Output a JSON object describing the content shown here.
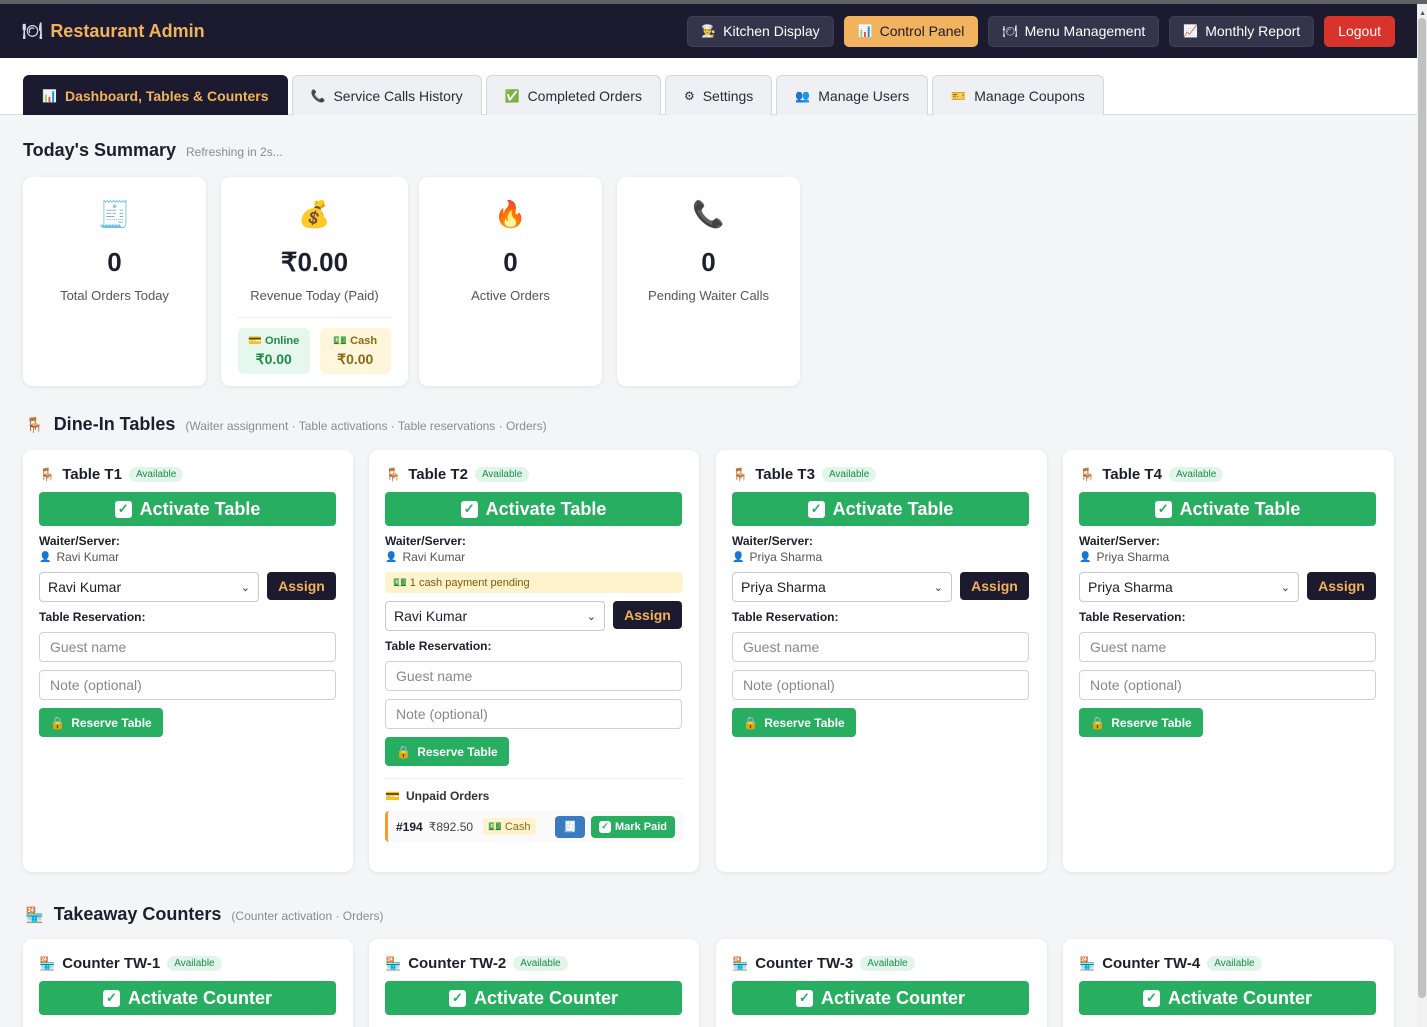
{
  "app": {
    "title": "Restaurant Admin"
  },
  "header_buttons": [
    {
      "label": "Kitchen Display",
      "icon": "chef-icon"
    },
    {
      "label": "Control Panel",
      "icon": "chart-icon"
    },
    {
      "label": "Menu Management",
      "icon": "plate-icon"
    },
    {
      "label": "Monthly Report",
      "icon": "trend-icon"
    }
  ],
  "logout_label": "Logout",
  "tabs": [
    {
      "label": "Dashboard, Tables & Counters",
      "icon": "chart-icon"
    },
    {
      "label": "Service Calls History",
      "icon": "phone-icon"
    },
    {
      "label": "Completed Orders",
      "icon": "check-icon"
    },
    {
      "label": "Settings",
      "icon": "gear-icon"
    },
    {
      "label": "Manage Users",
      "icon": "users-icon"
    },
    {
      "label": "Manage Coupons",
      "icon": "ticket-icon"
    }
  ],
  "summary": {
    "title": "Today's Summary",
    "refresh": "Refreshing in 2s...",
    "stats": [
      {
        "value": "0",
        "label": "Total Orders Today",
        "icon": "receipt-icon"
      },
      {
        "value": "₹0.00",
        "label": "Revenue Today (Paid)",
        "icon": "money-bag-icon"
      },
      {
        "value": "0",
        "label": "Active Orders",
        "icon": "fire-icon"
      },
      {
        "value": "0",
        "label": "Pending Waiter Calls",
        "icon": "phone-icon"
      }
    ],
    "online_label": "Online",
    "online_value": "₹0.00",
    "cash_label": "Cash",
    "cash_value": "₹0.00"
  },
  "dinein": {
    "title": "Dine-In Tables",
    "subtitle": "(Waiter assignment · Table activations · Table reservations · Orders)",
    "activate_label": "Activate Table",
    "waiter_label": "Waiter/Server:",
    "assign_label": "Assign",
    "reservation_label": "Table Reservation:",
    "guest_placeholder": "Guest name",
    "note_placeholder": "Note (optional)",
    "reserve_label": "Reserve Table",
    "status": "Available",
    "tables": [
      {
        "name": "Table T1",
        "waiter": "Ravi Kumar",
        "selected": "Ravi Kumar"
      },
      {
        "name": "Table T2",
        "waiter": "Ravi Kumar",
        "selected": "Ravi Kumar",
        "pending": "1 cash payment pending"
      },
      {
        "name": "Table T3",
        "waiter": "Priya Sharma",
        "selected": "Priya Sharma"
      },
      {
        "name": "Table T4",
        "waiter": "Priya Sharma",
        "selected": "Priya Sharma"
      }
    ],
    "unpaid": {
      "title": "Unpaid Orders",
      "order_num": "#194",
      "order_amount": "₹892.50",
      "method": "Cash",
      "mark_paid": "Mark Paid"
    }
  },
  "takeaway": {
    "title": "Takeaway Counters",
    "subtitle": "(Counter activation · Orders)",
    "activate_label": "Activate Counter",
    "status": "Available",
    "counters": [
      "Counter TW-1",
      "Counter TW-2",
      "Counter TW-3",
      "Counter TW-4"
    ]
  }
}
